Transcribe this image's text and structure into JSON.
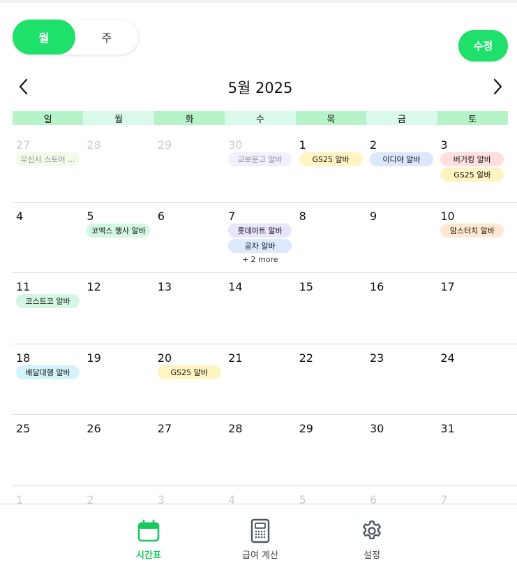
{
  "view_toggle": {
    "month": "월",
    "week": "주",
    "selected": "month"
  },
  "edit_label": "수정",
  "month_title": "5월 2025",
  "weekdays": [
    "일",
    "월",
    "화",
    "수",
    "목",
    "금",
    "토"
  ],
  "weeks": [
    [
      {
        "d": "27",
        "muted": true,
        "events": [
          {
            "t": "무신사 스토어 ...",
            "c": "#f1fbe8"
          }
        ]
      },
      {
        "d": "28",
        "muted": true,
        "events": []
      },
      {
        "d": "29",
        "muted": true,
        "events": []
      },
      {
        "d": "30",
        "muted": true,
        "events": [
          {
            "t": "교보문고 알바",
            "c": "#f1effc"
          }
        ]
      },
      {
        "d": "1",
        "events": [
          {
            "t": "GS25 알바",
            "c": "#fff4c2"
          }
        ]
      },
      {
        "d": "2",
        "events": [
          {
            "t": "이디야 알바",
            "c": "#dbe6ff"
          }
        ]
      },
      {
        "d": "3",
        "events": [
          {
            "t": "버거킹 알바",
            "c": "#ffdede"
          },
          {
            "t": "GS25 알바",
            "c": "#fff4c2"
          }
        ]
      }
    ],
    [
      {
        "d": "4",
        "events": []
      },
      {
        "d": "5",
        "events": [
          {
            "t": "코엑스 행사 알바",
            "c": "#d4f7e3"
          }
        ]
      },
      {
        "d": "6",
        "events": []
      },
      {
        "d": "7",
        "events": [
          {
            "t": "롯데마트 알바",
            "c": "#e7e4fb"
          },
          {
            "t": "공차 알바",
            "c": "#dce9ff"
          }
        ],
        "more": "+ 2 more"
      },
      {
        "d": "8",
        "events": []
      },
      {
        "d": "9",
        "events": []
      },
      {
        "d": "10",
        "events": [
          {
            "t": "맘스터치 알바",
            "c": "#ffe8cf"
          }
        ]
      }
    ],
    [
      {
        "d": "11",
        "events": [
          {
            "t": "코스트코 알바",
            "c": "#d4f7e3"
          }
        ]
      },
      {
        "d": "12",
        "events": []
      },
      {
        "d": "13",
        "events": []
      },
      {
        "d": "14",
        "events": []
      },
      {
        "d": "15",
        "events": []
      },
      {
        "d": "16",
        "events": []
      },
      {
        "d": "17",
        "events": []
      }
    ],
    [
      {
        "d": "18",
        "events": [
          {
            "t": "배달대행 알바",
            "c": "#d3f4fb"
          }
        ]
      },
      {
        "d": "19",
        "events": []
      },
      {
        "d": "20",
        "events": [
          {
            "t": "GS25 알바",
            "c": "#fff4c2"
          }
        ]
      },
      {
        "d": "21",
        "events": []
      },
      {
        "d": "22",
        "events": []
      },
      {
        "d": "23",
        "events": []
      },
      {
        "d": "24",
        "events": []
      }
    ],
    [
      {
        "d": "25",
        "events": []
      },
      {
        "d": "26",
        "events": []
      },
      {
        "d": "27",
        "events": []
      },
      {
        "d": "28",
        "events": []
      },
      {
        "d": "29",
        "events": []
      },
      {
        "d": "30",
        "events": []
      },
      {
        "d": "31",
        "events": []
      }
    ],
    [
      {
        "d": "1",
        "muted": true,
        "events": []
      },
      {
        "d": "2",
        "muted": true,
        "events": []
      },
      {
        "d": "3",
        "muted": true,
        "events": []
      },
      {
        "d": "4",
        "muted": true,
        "events": []
      },
      {
        "d": "5",
        "muted": true,
        "events": []
      },
      {
        "d": "6",
        "muted": true,
        "events": []
      },
      {
        "d": "7",
        "muted": true,
        "events": []
      }
    ]
  ],
  "bottom_nav": [
    {
      "label": "시간표",
      "icon": "calendar-icon",
      "active": true
    },
    {
      "label": "급여 계산",
      "icon": "calculator-icon",
      "active": false
    },
    {
      "label": "설정",
      "icon": "gear-icon",
      "active": false
    }
  ],
  "colors": {
    "accent": "#1ee06a",
    "accent_text": "#18c85e"
  }
}
